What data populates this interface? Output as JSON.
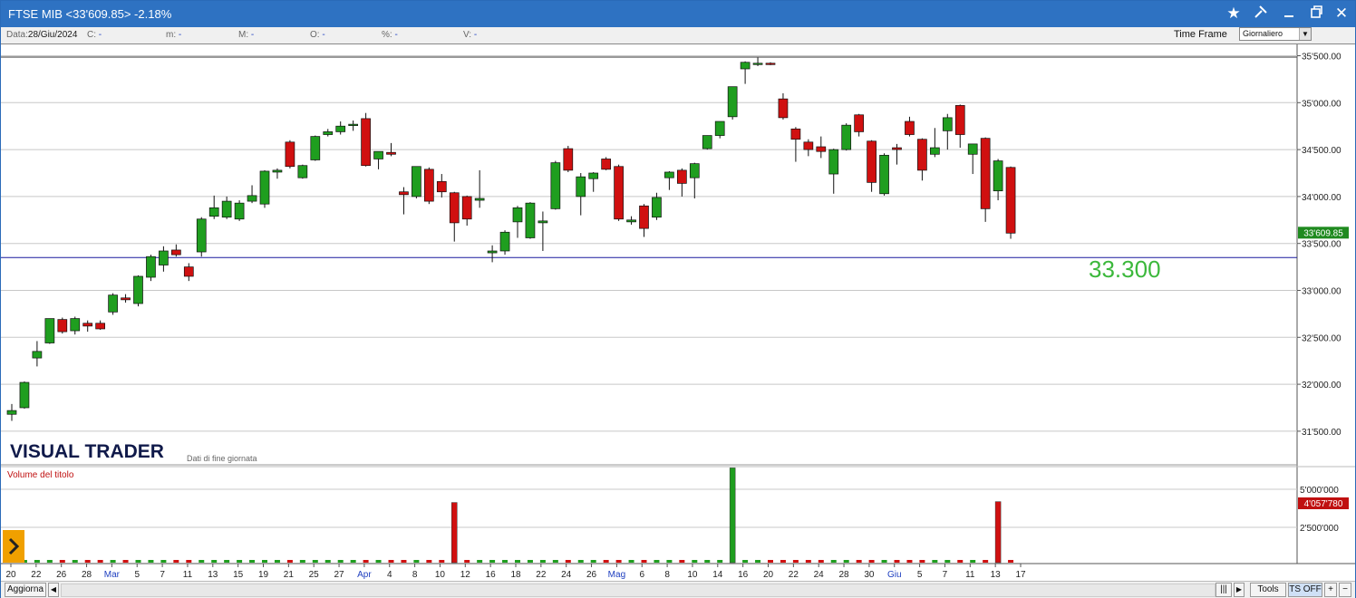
{
  "window": {
    "title": "FTSE MIB <33'609.85> -2.18%",
    "icons": [
      "star-icon",
      "pin-icon",
      "minimize-icon",
      "restore-icon",
      "close-icon"
    ]
  },
  "infobar": {
    "data_label": "Data:",
    "data_value": "28/Giu/2024",
    "fields": [
      {
        "label": "C:",
        "value": "-"
      },
      {
        "label": "m:",
        "value": "-"
      },
      {
        "label": "M:",
        "value": "-"
      },
      {
        "label": "O:",
        "value": "-"
      },
      {
        "label": "%:",
        "value": "-"
      },
      {
        "label": "V:",
        "value": "-"
      }
    ],
    "time_frame_label": "Time Frame",
    "time_frame_value": "Giornaliero"
  },
  "chart": {
    "brand": "VISUAL TRADER",
    "brand_sub": "Dati di fine giornata",
    "price_axis_labels": [
      "35'500.00",
      "35'000.00",
      "34'500.00",
      "34'000.00",
      "33'500.00",
      "33'000.00",
      "32'500.00",
      "32'000.00",
      "31'500.00"
    ],
    "current_price_label": "33'609.85",
    "annotation_text": "33.300",
    "volume_title": "Volume del titolo",
    "volume_axis_labels": [
      "5'000'000",
      "2'500'000"
    ],
    "current_volume_label": "4'057'780",
    "date_labels": [
      "20",
      "22",
      "26",
      "28",
      "Mar",
      "5",
      "7",
      "11",
      "13",
      "15",
      "19",
      "21",
      "25",
      "27",
      "Apr",
      "4",
      "8",
      "10",
      "12",
      "16",
      "18",
      "22",
      "24",
      "26",
      "Mag",
      "6",
      "8",
      "10",
      "14",
      "16",
      "20",
      "22",
      "24",
      "28",
      "30",
      "Giu",
      "5",
      "7",
      "11",
      "13",
      "17"
    ],
    "colors": {
      "up": "#1f9e1f",
      "down": "#d01010",
      "line": "#1a1a9e",
      "annotation": "#3cb83c",
      "last_price_bg": "#1f8a1f",
      "last_volume_bg": "#c01010"
    }
  },
  "chart_data": {
    "type": "candlestick",
    "price_axis_range": [
      31200,
      35500
    ],
    "horizontal_line_value": 33350,
    "ohlc": [
      {
        "o": 31680,
        "h": 31790,
        "l": 31610,
        "c": 31720
      },
      {
        "o": 31750,
        "h": 32030,
        "l": 31740,
        "c": 32020
      },
      {
        "o": 32280,
        "h": 32460,
        "l": 32190,
        "c": 32350
      },
      {
        "o": 32440,
        "h": 32700,
        "l": 32430,
        "c": 32700
      },
      {
        "o": 32690,
        "h": 32710,
        "l": 32540,
        "c": 32560
      },
      {
        "o": 32570,
        "h": 32720,
        "l": 32530,
        "c": 32700
      },
      {
        "o": 32650,
        "h": 32680,
        "l": 32560,
        "c": 32620
      },
      {
        "o": 32650,
        "h": 32680,
        "l": 32580,
        "c": 32590
      },
      {
        "o": 32770,
        "h": 32970,
        "l": 32740,
        "c": 32950
      },
      {
        "o": 32920,
        "h": 32960,
        "l": 32870,
        "c": 32900
      },
      {
        "o": 32860,
        "h": 33160,
        "l": 32830,
        "c": 33150
      },
      {
        "o": 33140,
        "h": 33380,
        "l": 33100,
        "c": 33360
      },
      {
        "o": 33270,
        "h": 33470,
        "l": 33200,
        "c": 33420
      },
      {
        "o": 33430,
        "h": 33490,
        "l": 33360,
        "c": 33380
      },
      {
        "o": 33250,
        "h": 33290,
        "l": 33100,
        "c": 33150
      },
      {
        "o": 33410,
        "h": 33780,
        "l": 33360,
        "c": 33760
      },
      {
        "o": 33790,
        "h": 34010,
        "l": 33760,
        "c": 33880
      },
      {
        "o": 33780,
        "h": 34000,
        "l": 33760,
        "c": 33950
      },
      {
        "o": 33760,
        "h": 33960,
        "l": 33740,
        "c": 33930
      },
      {
        "o": 33950,
        "h": 34120,
        "l": 33930,
        "c": 34010
      },
      {
        "o": 33920,
        "h": 34280,
        "l": 33880,
        "c": 34270
      },
      {
        "o": 34260,
        "h": 34300,
        "l": 34190,
        "c": 34280
      },
      {
        "o": 34580,
        "h": 34600,
        "l": 34300,
        "c": 34320
      },
      {
        "o": 34200,
        "h": 34340,
        "l": 34190,
        "c": 34330
      },
      {
        "o": 34390,
        "h": 34650,
        "l": 34380,
        "c": 34640
      },
      {
        "o": 34660,
        "h": 34720,
        "l": 34640,
        "c": 34690
      },
      {
        "o": 34690,
        "h": 34800,
        "l": 34660,
        "c": 34750
      },
      {
        "o": 34760,
        "h": 34810,
        "l": 34700,
        "c": 34770
      },
      {
        "o": 34830,
        "h": 34890,
        "l": 34320,
        "c": 34330
      },
      {
        "o": 34400,
        "h": 34440,
        "l": 34290,
        "c": 34480
      },
      {
        "o": 34470,
        "h": 34570,
        "l": 34430,
        "c": 34450
      },
      {
        "o": 34050,
        "h": 34100,
        "l": 33810,
        "c": 34020
      },
      {
        "o": 34000,
        "h": 34320,
        "l": 33980,
        "c": 34320
      },
      {
        "o": 34290,
        "h": 34310,
        "l": 33920,
        "c": 33950
      },
      {
        "o": 34160,
        "h": 34240,
        "l": 33990,
        "c": 34050
      },
      {
        "o": 34040,
        "h": 34050,
        "l": 33520,
        "c": 33720
      },
      {
        "o": 34000,
        "h": 34010,
        "l": 33690,
        "c": 33760
      },
      {
        "o": 33960,
        "h": 34280,
        "l": 33880,
        "c": 33980
      },
      {
        "o": 33400,
        "h": 33480,
        "l": 33300,
        "c": 33420
      },
      {
        "o": 33420,
        "h": 33640,
        "l": 33380,
        "c": 33620
      },
      {
        "o": 33730,
        "h": 33900,
        "l": 33560,
        "c": 33880
      },
      {
        "o": 33560,
        "h": 33940,
        "l": 33550,
        "c": 33930
      },
      {
        "o": 33720,
        "h": 33840,
        "l": 33420,
        "c": 33740
      },
      {
        "o": 33870,
        "h": 34380,
        "l": 33860,
        "c": 34360
      },
      {
        "o": 34510,
        "h": 34540,
        "l": 34260,
        "c": 34280
      },
      {
        "o": 34000,
        "h": 34250,
        "l": 33800,
        "c": 34210
      },
      {
        "o": 34190,
        "h": 34260,
        "l": 34050,
        "c": 34250
      },
      {
        "o": 34400,
        "h": 34420,
        "l": 34280,
        "c": 34290
      },
      {
        "o": 34320,
        "h": 34340,
        "l": 33740,
        "c": 33760
      },
      {
        "o": 33730,
        "h": 33790,
        "l": 33700,
        "c": 33750
      },
      {
        "o": 33900,
        "h": 33920,
        "l": 33570,
        "c": 33660
      },
      {
        "o": 33780,
        "h": 34040,
        "l": 33750,
        "c": 33990
      },
      {
        "o": 34200,
        "h": 34270,
        "l": 34070,
        "c": 34260
      },
      {
        "o": 34280,
        "h": 34300,
        "l": 34000,
        "c": 34140
      },
      {
        "o": 34200,
        "h": 34360,
        "l": 33980,
        "c": 34350
      },
      {
        "o": 34510,
        "h": 34520,
        "l": 34500,
        "c": 34650
      },
      {
        "o": 34650,
        "h": 34760,
        "l": 34620,
        "c": 34800
      },
      {
        "o": 34850,
        "h": 35170,
        "l": 34820,
        "c": 35170
      },
      {
        "o": 35360,
        "h": 35440,
        "l": 35200,
        "c": 35430
      },
      {
        "o": 35410,
        "h": 35480,
        "l": 35390,
        "c": 35420
      },
      {
        "o": 35420,
        "h": 35430,
        "l": 35400,
        "c": 35410
      },
      {
        "o": 35040,
        "h": 35100,
        "l": 34820,
        "c": 34840
      },
      {
        "o": 34720,
        "h": 34740,
        "l": 34370,
        "c": 34610
      },
      {
        "o": 34580,
        "h": 34610,
        "l": 34430,
        "c": 34500
      },
      {
        "o": 34530,
        "h": 34640,
        "l": 34410,
        "c": 34480
      },
      {
        "o": 34240,
        "h": 34510,
        "l": 34030,
        "c": 34500
      },
      {
        "o": 34500,
        "h": 34780,
        "l": 34490,
        "c": 34760
      },
      {
        "o": 34870,
        "h": 34880,
        "l": 34640,
        "c": 34690
      },
      {
        "o": 34590,
        "h": 34600,
        "l": 34050,
        "c": 34150
      },
      {
        "o": 34030,
        "h": 34460,
        "l": 34010,
        "c": 34440
      },
      {
        "o": 34520,
        "h": 34560,
        "l": 34340,
        "c": 34500
      },
      {
        "o": 34800,
        "h": 34850,
        "l": 34640,
        "c": 34660
      },
      {
        "o": 34610,
        "h": 34620,
        "l": 34170,
        "c": 34280
      },
      {
        "o": 34450,
        "h": 34730,
        "l": 34420,
        "c": 34520
      },
      {
        "o": 34700,
        "h": 34880,
        "l": 34500,
        "c": 34840
      },
      {
        "o": 34970,
        "h": 34980,
        "l": 34520,
        "c": 34660
      },
      {
        "o": 34450,
        "h": 34560,
        "l": 34240,
        "c": 34560
      },
      {
        "o": 34620,
        "h": 34630,
        "l": 33730,
        "c": 33870
      },
      {
        "o": 34060,
        "h": 34400,
        "l": 33960,
        "c": 34380
      },
      {
        "o": 34310,
        "h": 34320,
        "l": 33550,
        "c": 33610
      }
    ],
    "volume": {
      "title": "Volume del titolo",
      "axis_labels": [
        "5'000'000",
        "2'500'000"
      ],
      "notable_values": [
        {
          "date": "11 Apr",
          "value": 4000000,
          "color": "red"
        },
        {
          "date": "15 Mag",
          "value": 6300000,
          "color": "green"
        },
        {
          "date": "13 Giu",
          "value": 4057780,
          "color": "red"
        }
      ],
      "last_value": 4057780
    },
    "x_tick_labels": [
      "20",
      "22",
      "26",
      "28",
      "Mar",
      "5",
      "7",
      "11",
      "13",
      "15",
      "19",
      "21",
      "25",
      "27",
      "Apr",
      "4",
      "8",
      "10",
      "12",
      "16",
      "18",
      "22",
      "24",
      "26",
      "Mag",
      "6",
      "8",
      "10",
      "14",
      "16",
      "20",
      "22",
      "24",
      "28",
      "30",
      "Giu",
      "5",
      "7",
      "11",
      "13",
      "17"
    ]
  },
  "bottombar": {
    "refresh_label": "Aggiorna",
    "tools_label": "Tools",
    "ts_label": "TS OFF",
    "zoom_in": "+",
    "zoom_out": "−"
  }
}
